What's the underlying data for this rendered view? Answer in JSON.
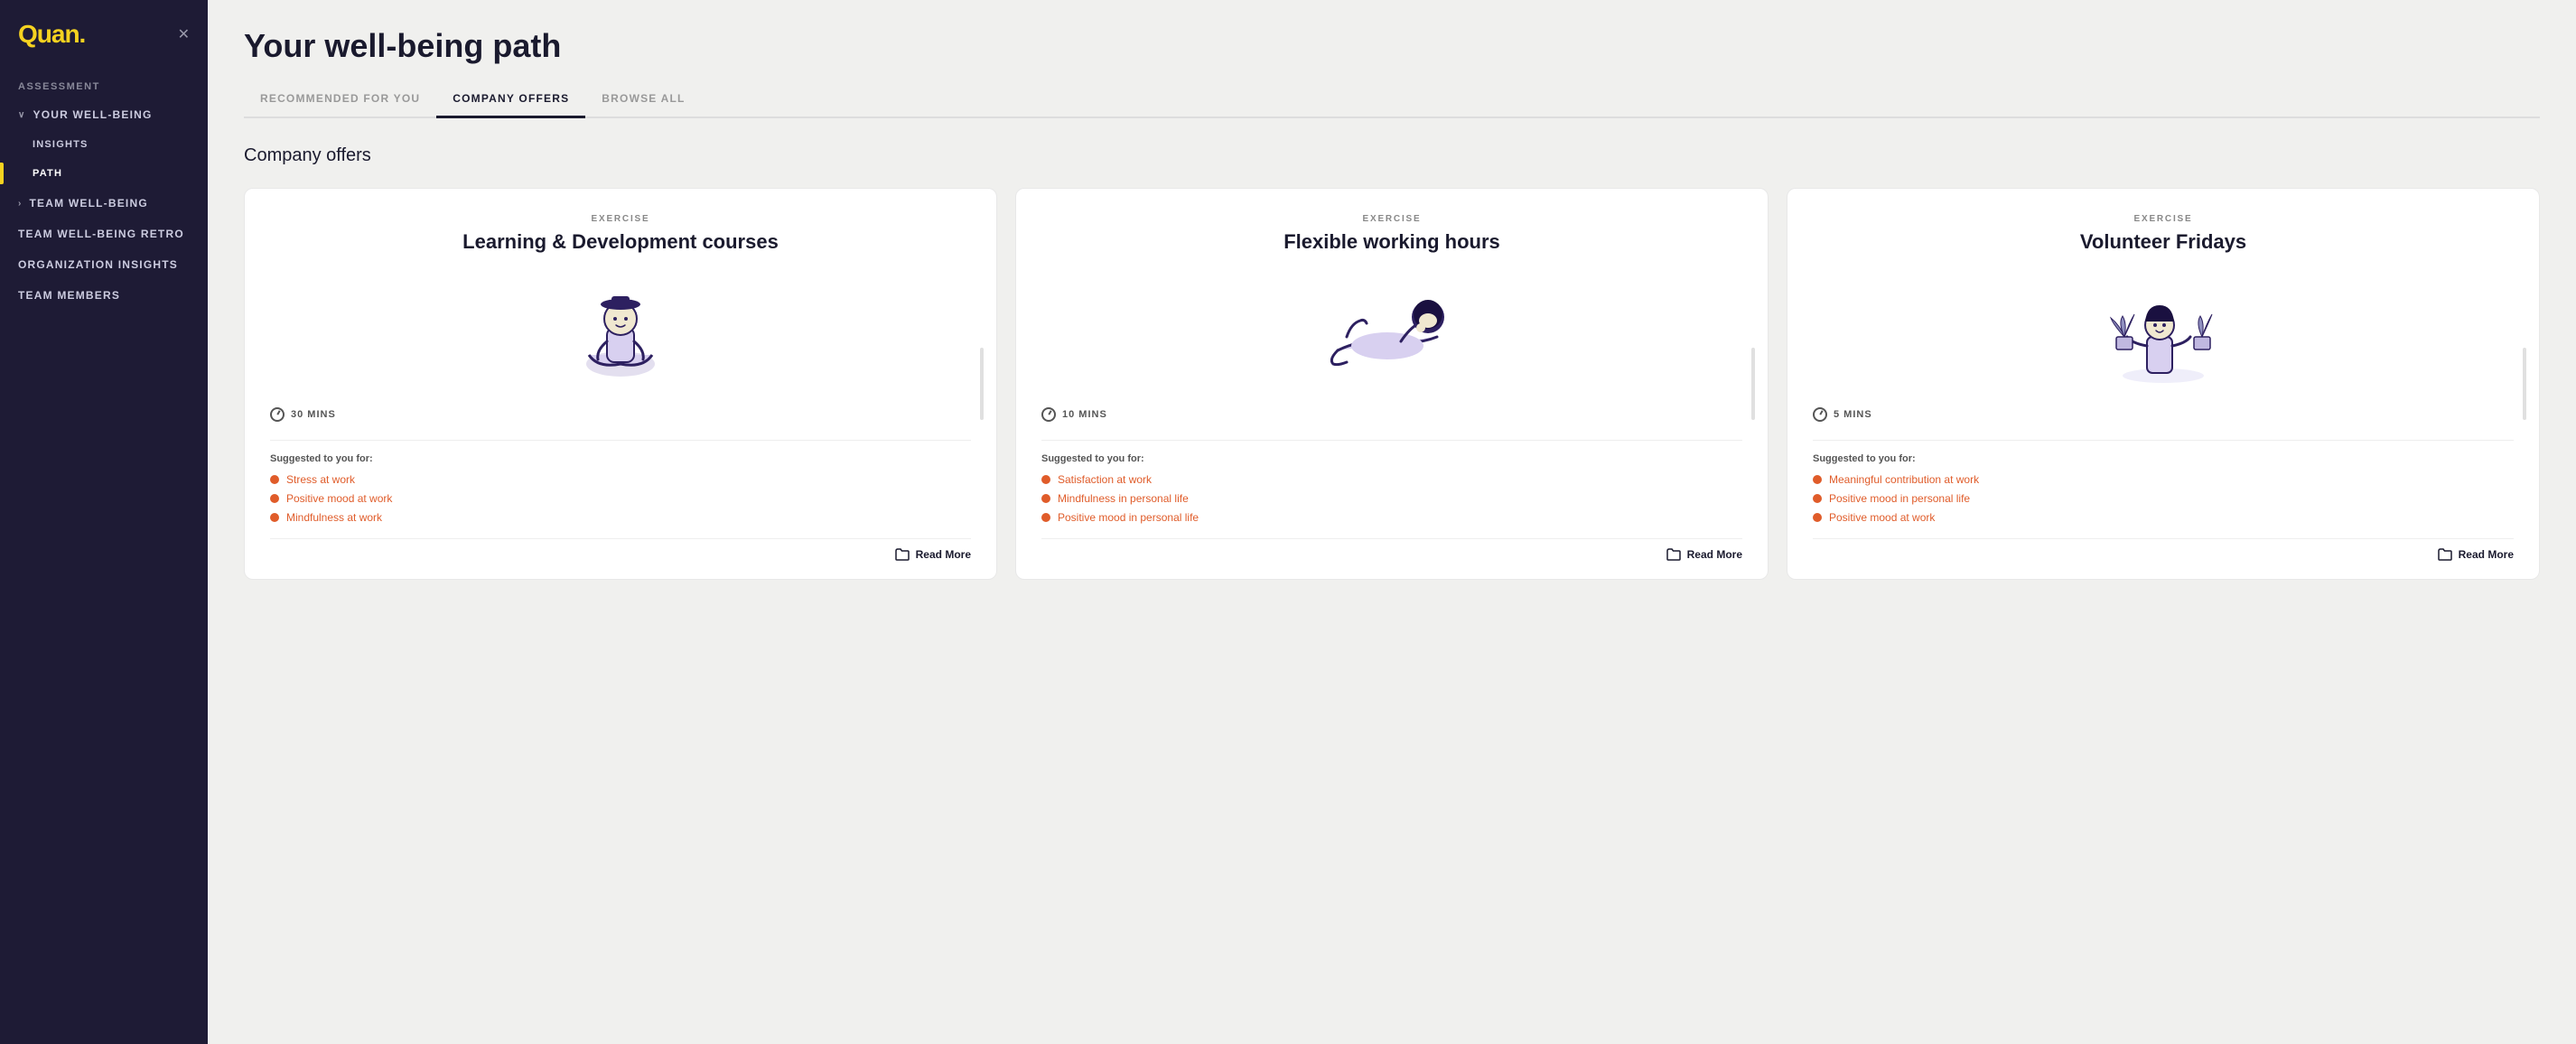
{
  "sidebar": {
    "logo": "Quan.",
    "sections": [
      {
        "label": "ASSESSMENT",
        "items": []
      }
    ],
    "nav_items": [
      {
        "id": "your-well-being",
        "label": "YOUR WELL-BEING",
        "has_chevron": true,
        "expanded": true,
        "active": false,
        "sub": true
      },
      {
        "id": "insights",
        "label": "INSIGHTS",
        "active": false,
        "sub_item": true
      },
      {
        "id": "path",
        "label": "PATH",
        "active": true,
        "sub_item": true
      },
      {
        "id": "team-well-being",
        "label": "TEAM WELL-BEING",
        "has_chevron": true,
        "active": false
      },
      {
        "id": "team-well-being-retro",
        "label": "TEAM WELL-BEING RETRO",
        "active": false
      },
      {
        "id": "organization-insights",
        "label": "ORGANIZATION INSIGHTS",
        "active": false
      },
      {
        "id": "team-members",
        "label": "TEAM MEMBERS",
        "active": false
      }
    ]
  },
  "header": {
    "page_title": "Your well-being path",
    "tabs": [
      {
        "id": "recommended",
        "label": "RECOMMENDED FOR YOU",
        "active": false
      },
      {
        "id": "company-offers",
        "label": "COMPANY OFFERS",
        "active": true
      },
      {
        "id": "browse-all",
        "label": "BROWSE ALL",
        "active": false
      }
    ]
  },
  "main": {
    "section_title": "Company offers",
    "cards": [
      {
        "type": "EXERCISE",
        "title": "Learning & Development courses",
        "duration": "30 MINS",
        "suggested_label": "Suggested to you for:",
        "tags": [
          "Stress at work",
          "Positive mood at work",
          "Mindfulness at work"
        ],
        "read_more": "Read More"
      },
      {
        "type": "EXERCISE",
        "title": "Flexible working hours",
        "duration": "10 MINS",
        "suggested_label": "Suggested to you for:",
        "tags": [
          "Satisfaction at work",
          "Mindfulness in personal life",
          "Positive mood in personal life"
        ],
        "read_more": "Read More"
      },
      {
        "type": "EXERCISE",
        "title": "Volunteer Fridays",
        "duration": "5 MINS",
        "suggested_label": "Suggested to you for:",
        "tags": [
          "Meaningful contribution at work",
          "Positive mood in personal life",
          "Positive mood at work"
        ],
        "read_more": "Read More"
      }
    ]
  },
  "icons": {
    "close": "✕",
    "chevron_down": "∨",
    "chevron_right": "›",
    "folder": "🗂",
    "clock": "⏱"
  }
}
